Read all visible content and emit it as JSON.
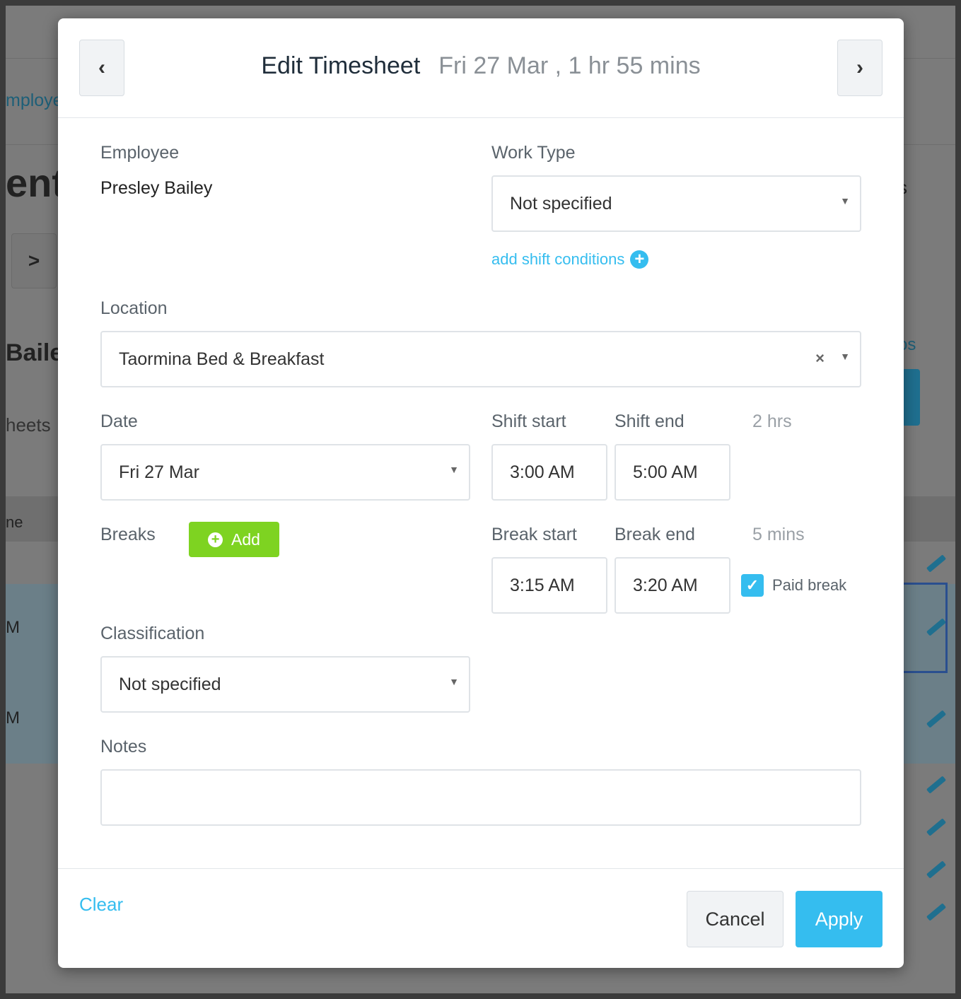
{
  "background": {
    "fragments": [
      "mploye",
      "ent",
      "Bailey",
      "heets",
      "ne",
      "M",
      "M",
      "s",
      "os"
    ]
  },
  "modal": {
    "title": "Edit Timesheet",
    "subtitle": "Fri 27 Mar , 1 hr 55 mins",
    "employee": {
      "label": "Employee",
      "value": "Presley Bailey"
    },
    "work_type": {
      "label": "Work Type",
      "value": "Not specified"
    },
    "add_shift_conditions": "add shift conditions",
    "location": {
      "label": "Location",
      "value": "Taormina Bed & Breakfast"
    },
    "date": {
      "label": "Date",
      "value": "Fri 27 Mar"
    },
    "shift": {
      "start_label": "Shift start",
      "end_label": "Shift end",
      "start": "3:00 AM",
      "end": "5:00 AM",
      "duration": "2 hrs"
    },
    "breaks": {
      "label": "Breaks",
      "add_label": "Add",
      "start_label": "Break start",
      "end_label": "Break end",
      "start": "3:15 AM",
      "end": "3:20 AM",
      "duration": "5 mins",
      "paid_label": "Paid break",
      "paid": true
    },
    "classification": {
      "label": "Classification",
      "value": "Not specified"
    },
    "notes": {
      "label": "Notes",
      "value": ""
    },
    "footer": {
      "clear": "Clear",
      "cancel": "Cancel",
      "apply": "Apply"
    }
  },
  "colors": {
    "accent": "#35bdef",
    "add_green": "#7ed321"
  }
}
